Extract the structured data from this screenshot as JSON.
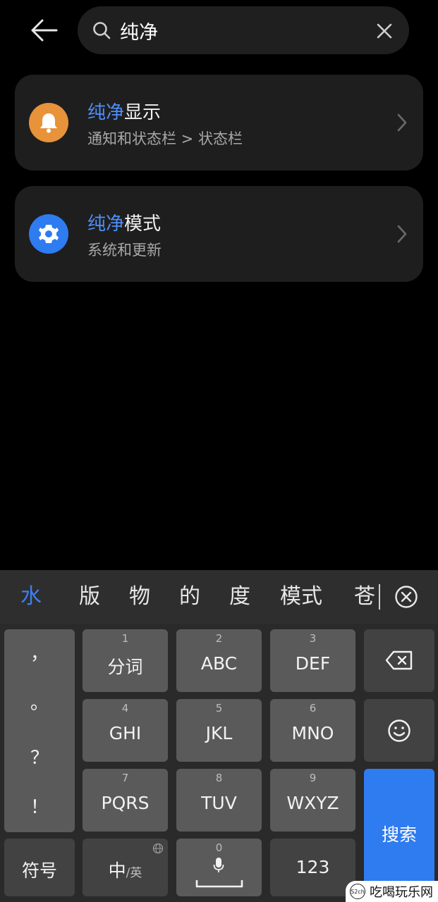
{
  "search": {
    "query": "纯净",
    "placeholder": ""
  },
  "results": [
    {
      "title_highlight": "纯净",
      "title_rest": "显示",
      "subtitle": "通知和状态栏 > 状态栏",
      "icon": "bell-icon",
      "icon_color": "#e8923a"
    },
    {
      "title_highlight": "纯净",
      "title_rest": "模式",
      "subtitle": "系统和更新",
      "icon": "gear-icon",
      "icon_color": "#2f7bf0"
    }
  ],
  "keyboard": {
    "candidates": [
      "水",
      "版",
      "物",
      "的",
      "度",
      "模式",
      "苍"
    ],
    "punctuation": [
      "，",
      "。",
      "？",
      "！"
    ],
    "keys": {
      "k1": {
        "num": "1",
        "label": "分词"
      },
      "k2": {
        "num": "2",
        "label": "ABC"
      },
      "k3": {
        "num": "3",
        "label": "DEF"
      },
      "k4": {
        "num": "4",
        "label": "GHI"
      },
      "k5": {
        "num": "5",
        "label": "JKL"
      },
      "k6": {
        "num": "6",
        "label": "MNO"
      },
      "k7": {
        "num": "7",
        "label": "PQRS"
      },
      "k8": {
        "num": "8",
        "label": "TUV"
      },
      "k9": {
        "num": "9",
        "label": "WXYZ"
      },
      "k0": {
        "num": "0"
      }
    },
    "symbols_label": "符号",
    "lang_primary": "中",
    "lang_secondary": "/英",
    "numbers_label": "123",
    "search_label": "搜索"
  },
  "watermark": {
    "logo_text": "S2ch",
    "text": "吃喝玩乐网"
  },
  "colors": {
    "highlight": "#4d8ef8",
    "accent": "#2f7bf0"
  }
}
